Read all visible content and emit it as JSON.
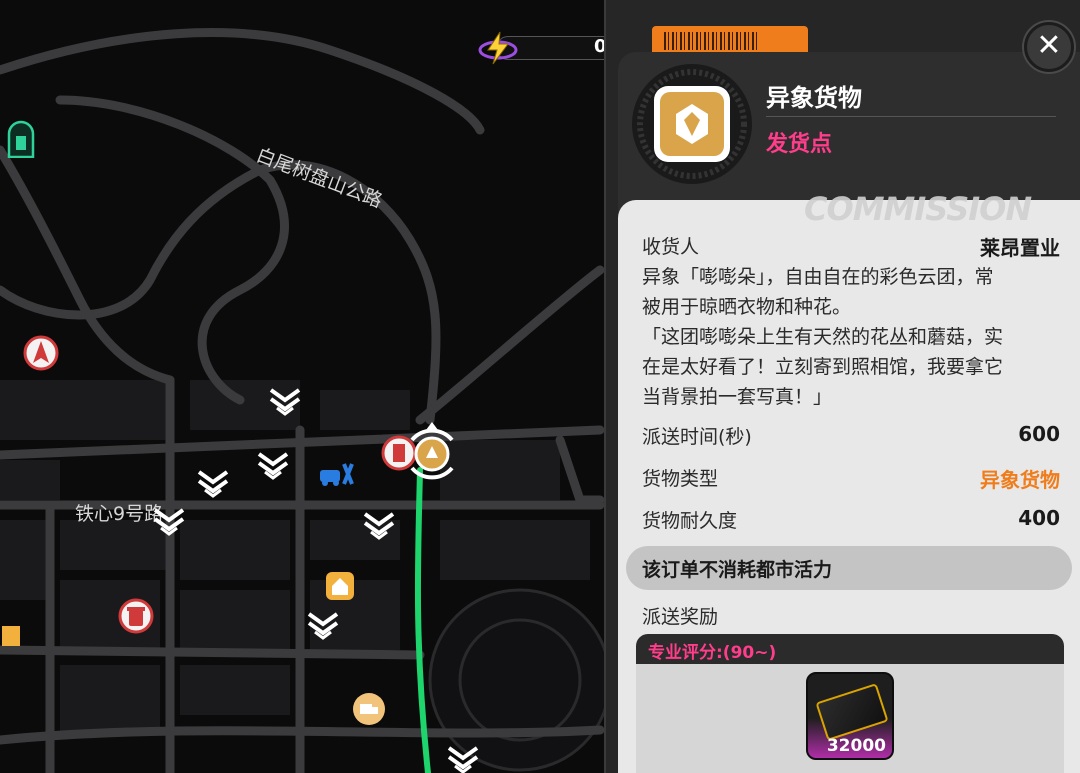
{
  "hud": {
    "energy_value": "0"
  },
  "map": {
    "road_labels": [
      "白尾树盘山公路",
      "铁心9号路"
    ],
    "colors": {
      "background": "#0b0b0c",
      "roads": "#3b3b3d",
      "blocks": "#1a1a1c",
      "route": "#1ed46c",
      "gold": "#d9a44a"
    }
  },
  "panel": {
    "title": "异象货物",
    "subtitle": "发货点",
    "watermark": "COMMISSION",
    "close_symbol": "✕",
    "recipient_label": "收货人",
    "recipient_value": "莱昂置业",
    "description_lines": [
      "异象「嘭嘭朵」，自由自在的彩色云团，常",
      "被用于晾晒衣物和种花。",
      "「这团嘭嘭朵上生有天然的花丛和蘑菇，实",
      "在是太好看了！立刻寄到照相馆，我要拿它",
      "当背景拍一套写真！」"
    ],
    "stats": [
      {
        "label": "派送时间(秒)",
        "value": "600",
        "highlight": false
      },
      {
        "label": "货物类型",
        "value": "异象货物",
        "highlight": true
      },
      {
        "label": "货物耐久度",
        "value": "400",
        "highlight": false
      }
    ],
    "note": "该订单不消耗都市活力",
    "reward_label": "派送奖励",
    "reward_tier": "专业评分:(90~)",
    "reward_item_qty": "32000",
    "colors": {
      "accent_pink": "#ff3d8b",
      "accent_orange": "#f07d1c",
      "panel_dark": "#262626",
      "panel_light": "#e8e8e8"
    }
  }
}
